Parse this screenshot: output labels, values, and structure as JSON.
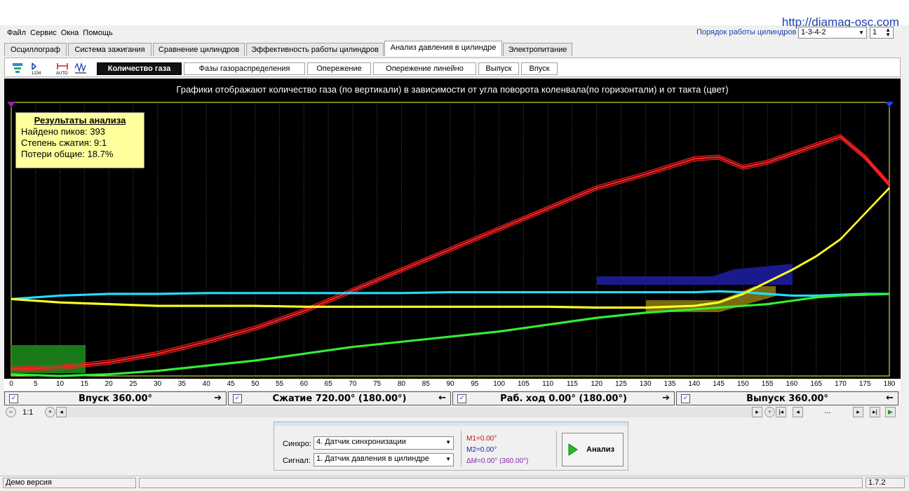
{
  "url": "http://diamag-osc.com",
  "menu": [
    "Файл",
    "Сервис",
    "Окна",
    "Помощь"
  ],
  "cylinder_order": {
    "label": "Порядок работы цилиндров",
    "value": "1-3-4-2",
    "cylinder": "1"
  },
  "main_tabs": [
    {
      "label": "Осциллограф"
    },
    {
      "label": "Система зажигания"
    },
    {
      "label": "Сравнение цилиндров"
    },
    {
      "label": "Эффективность работы цилиндров"
    },
    {
      "label": "Анализ давления в цилиндре"
    },
    {
      "label": "Электропитание"
    }
  ],
  "sub_tabs": [
    {
      "label": "Количество газа"
    },
    {
      "label": "Фазы газораспределения"
    },
    {
      "label": "Опережение"
    },
    {
      "label": "Опережение линейно"
    },
    {
      "label": "Выпуск"
    },
    {
      "label": "Впуск"
    }
  ],
  "chart": {
    "title": "Графики отображают количество газа (по вертикали) в зависимости от угла поворота коленвала(по горизонтали) и от такта (цвет)",
    "x_ticks": [
      "0",
      "5",
      "10",
      "15",
      "20",
      "25",
      "30",
      "35",
      "40",
      "45",
      "50",
      "55",
      "60",
      "65",
      "70",
      "75",
      "80",
      "85",
      "90",
      "95",
      "100",
      "105",
      "110",
      "115",
      "120",
      "125",
      "130",
      "135",
      "140",
      "145",
      "150",
      "155",
      "160",
      "165",
      "170",
      "175",
      "180"
    ]
  },
  "results": {
    "title": "Результаты анализа",
    "peaks": "Найдено пиков: 393",
    "compression": "Степень сжатия: 9:1",
    "losses": "Потери общие: 18.7%"
  },
  "phases": [
    {
      "label": "Впуск 360.00°",
      "color": "#33ee33",
      "arrow": "➔"
    },
    {
      "label": "Сжатие 720.00° (180.00°)",
      "color": "#22eeee",
      "arrow": "🡐"
    },
    {
      "label": "Раб. ход 0.00° (180.00°)",
      "color": "#ffff22",
      "arrow": "➔"
    },
    {
      "label": "Выпуск 360.00°",
      "color": "#ff2222",
      "arrow": "🡐"
    }
  ],
  "zoom": {
    "ratio": "1:1",
    "dots": "..."
  },
  "bottom": {
    "sync_label": "Синхро:",
    "sync_value": "4.  Датчик синхронизации",
    "signal_label": "Сигнал:",
    "signal_value": "1.  Датчик давления в цилиндре",
    "m1": "M1=0.00°",
    "m2": "M2=0.00°",
    "dm": "ΔM=0.00° (360.00°)",
    "analyze_label": "Анализ"
  },
  "status": {
    "left": "Демо версия",
    "version": "1.7.2"
  },
  "chart_data": {
    "type": "line",
    "xlim": [
      0,
      180
    ],
    "x": [
      0,
      10,
      20,
      30,
      40,
      50,
      60,
      70,
      80,
      90,
      100,
      110,
      120,
      130,
      140,
      145,
      150,
      155,
      160,
      165,
      170,
      175,
      180
    ],
    "series": [
      {
        "color": "#ff2020",
        "values": [
          4,
          5,
          8,
          13,
          20,
          28,
          38,
          50,
          62,
          74,
          86,
          98,
          110,
          118,
          127,
          128,
          122,
          125,
          130,
          135,
          140,
          128,
          112
        ]
      },
      {
        "color": "#22ddff",
        "values": [
          45,
          47,
          48,
          48,
          48.5,
          48.5,
          48.5,
          48.5,
          48.5,
          49,
          49,
          49,
          49,
          49,
          49,
          49.5,
          49,
          48,
          47,
          47,
          47.5,
          48,
          48
        ]
      },
      {
        "color": "#ffff22",
        "values": [
          45,
          43,
          42,
          41,
          41,
          41,
          40.5,
          40.5,
          40.5,
          40.5,
          40.5,
          40.5,
          40,
          40,
          41,
          43,
          48,
          55,
          62,
          70,
          80,
          95,
          110
        ]
      },
      {
        "color": "#33ee33",
        "values": [
          1,
          0,
          1,
          3,
          6,
          9,
          13,
          17,
          20,
          23,
          26,
          30,
          34,
          37,
          39,
          40,
          41,
          42,
          44,
          46,
          47,
          47.5,
          48
        ]
      }
    ],
    "ylim": [
      0,
      160
    ],
    "grid": true
  }
}
